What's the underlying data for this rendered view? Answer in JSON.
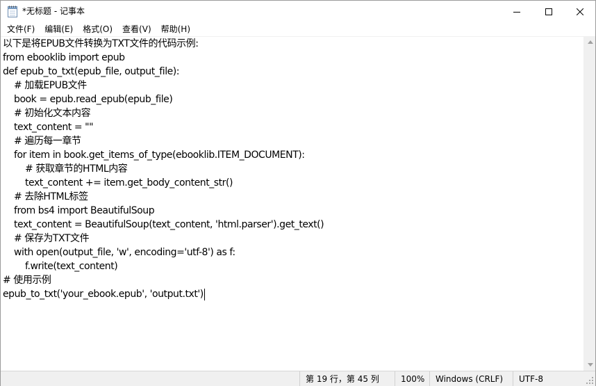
{
  "window": {
    "title": "*无标题 - 记事本",
    "app_icon": "notepad-icon",
    "controls": [
      "minimize-icon",
      "maximize-icon",
      "close-icon"
    ]
  },
  "menu": {
    "items": [
      "文件(F)",
      "编辑(E)",
      "格式(O)",
      "查看(V)",
      "帮助(H)"
    ]
  },
  "editor": {
    "lines": [
      "以下是将EPUB文件转换为TXT文件的代码示例:",
      "from ebooklib import epub",
      "def epub_to_txt(epub_file, output_file):",
      "    # 加载EPUB文件",
      "    book = epub.read_epub(epub_file)",
      "    # 初始化文本内容",
      "    text_content = \"\"",
      "    # 遍历每一章节",
      "    for item in book.get_items_of_type(ebooklib.ITEM_DOCUMENT):",
      "        # 获取章节的HTML内容",
      "        text_content += item.get_body_content_str()",
      "    # 去除HTML标签",
      "    from bs4 import BeautifulSoup",
      "    text_content = BeautifulSoup(text_content, 'html.parser').get_text()",
      "    # 保存为TXT文件",
      "    with open(output_file, 'w', encoding='utf-8') as f:",
      "        f.write(text_content)",
      "# 使用示例",
      "epub_to_txt('your_ebook.epub', 'output.txt')"
    ]
  },
  "status": {
    "position": "第 19 行，第 45 列",
    "zoom": "100%",
    "line_ending": "Windows (CRLF)",
    "encoding": "UTF-8"
  },
  "colors": {
    "chrome": "#f0f0f0",
    "text": "#000000",
    "editor_bg": "#ffffff"
  }
}
